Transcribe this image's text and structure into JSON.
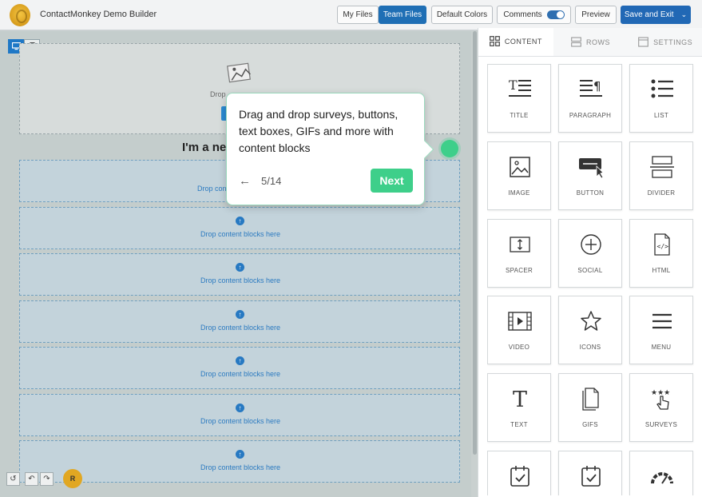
{
  "header": {
    "app_title": "ContactMonkey Demo Builder",
    "my_files": "My Files",
    "team_files": "Team Files",
    "default_colors": "Default Colors",
    "comments": "Comments",
    "preview": "Preview",
    "save_exit": "Save and Exit"
  },
  "canvas": {
    "hero_drop_text": "Drop",
    "heading": "I'm a ne",
    "first_zone_label": "Drop cont",
    "drop_label": "Drop content blocks here",
    "avatar_initial": "R"
  },
  "tooltip": {
    "text": "Drag and drop surveys, buttons, text boxes, GIFs and more with content blocks",
    "back": "←",
    "step": "5/14",
    "next": "Next"
  },
  "sidebar": {
    "tabs": [
      {
        "label": "CONTENT",
        "icon": "grid-icon",
        "active": true
      },
      {
        "label": "ROWS",
        "icon": "rows-icon",
        "active": false
      },
      {
        "label": "SETTINGS",
        "icon": "settings-icon",
        "active": false
      }
    ],
    "blocks": [
      "TITLE",
      "PARAGRAPH",
      "LIST",
      "IMAGE",
      "BUTTON",
      "DIVIDER",
      "SPACER",
      "SOCIAL",
      "HTML",
      "VIDEO",
      "ICONS",
      "MENU",
      "TEXT",
      "GIFS",
      "SURVEYS"
    ]
  },
  "colors": {
    "primary": "#1f6fb5",
    "accent_green": "#3ecf8a",
    "drop_zone_text": "#2b7ac0"
  }
}
